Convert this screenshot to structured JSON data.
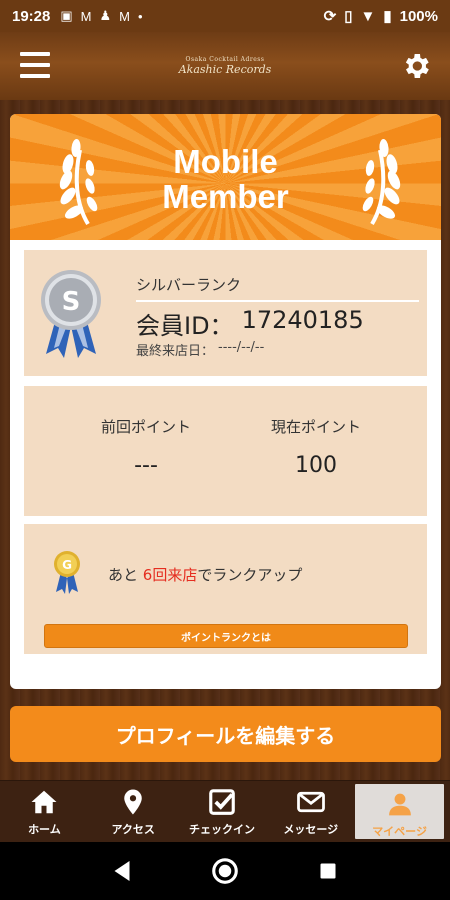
{
  "status_bar": {
    "time": "19:28",
    "battery": "100%"
  },
  "header": {
    "logo_small": "Osaka Cocktail Adress",
    "logo_big": "Akashic Records"
  },
  "banner": {
    "title_line1": "Mobile",
    "title_line2": "Member"
  },
  "rank": {
    "name": "シルバーランク",
    "member_id_label": "会員ID：",
    "member_id": "17240185",
    "last_visit_label": "最終来店日：",
    "last_visit": "----/--/--",
    "medal_letter": "S"
  },
  "points": {
    "previous_label": "前回ポイント",
    "previous_value": "---",
    "current_label": "現在ポイント",
    "current_value": "100"
  },
  "next_rank": {
    "prefix": "あと",
    "highlight": "6回来店",
    "suffix": "でランクアップ",
    "medal_letter": "G",
    "about_button": "ポイントランクとは"
  },
  "edit_profile_button": "プロフィールを編集する",
  "tabs": [
    {
      "label": "ホーム",
      "icon": "home-icon"
    },
    {
      "label": "アクセス",
      "icon": "map-pin-icon"
    },
    {
      "label": "チェックイン",
      "icon": "checkbox-icon"
    },
    {
      "label": "メッセージ",
      "icon": "mail-icon"
    },
    {
      "label": "マイページ",
      "icon": "person-icon"
    }
  ],
  "colors": {
    "accent": "#f38b1b",
    "panel": "#f3dcc3",
    "highlight": "#e52d20",
    "header": "#6e3c15"
  }
}
